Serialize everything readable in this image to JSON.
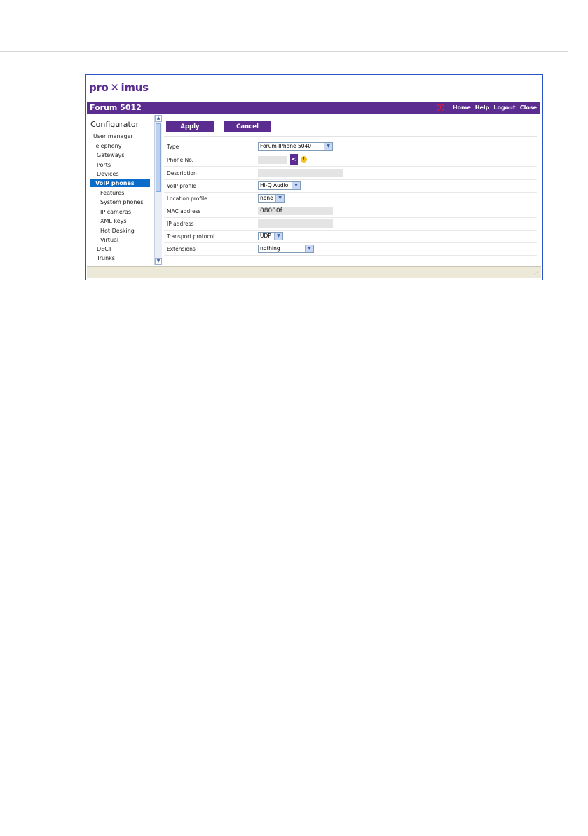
{
  "brand": {
    "logo_left": "pro",
    "logo_x": "✕",
    "logo_right": "imus"
  },
  "titlebar": {
    "title": "Forum 5012",
    "nav": {
      "home": "Home",
      "help": "Help",
      "logout": "Logout",
      "close": "Close"
    },
    "info_icon": "i"
  },
  "sidebar": {
    "title": "Configurator",
    "items": [
      {
        "label": "User manager"
      },
      {
        "label": "Telephony"
      },
      {
        "label": "Gateways"
      },
      {
        "label": "Ports"
      },
      {
        "label": "Devices"
      },
      {
        "label": "VoIP phones"
      },
      {
        "label": "Features"
      },
      {
        "label": "System phones"
      },
      {
        "label": "IP cameras"
      },
      {
        "label": "XML keys"
      },
      {
        "label": "Hot Desking"
      },
      {
        "label": "Virtual"
      },
      {
        "label": "DECT"
      },
      {
        "label": "Trunks"
      }
    ]
  },
  "toolbar": {
    "apply": "Apply",
    "cancel": "Cancel"
  },
  "form": {
    "type": {
      "label": "Type",
      "value": "Forum IPhone 5040"
    },
    "phone_no": {
      "label": "Phone No.",
      "value": "",
      "pick": "<",
      "warn": "!"
    },
    "description": {
      "label": "Description",
      "value": ""
    },
    "voip_profile": {
      "label": "VoIP profile",
      "value": "Hi-Q Audio"
    },
    "location_profile": {
      "label": "Location profile",
      "value": "none"
    },
    "mac_address": {
      "label": "MAC address",
      "value": "08000f"
    },
    "ip_address": {
      "label": "IP address",
      "value": ""
    },
    "transport_protocol": {
      "label": "Transport protocol",
      "value": "UDP"
    },
    "extensions": {
      "label": "Extensions",
      "value": "nothing"
    }
  },
  "icons": {
    "scroll_up": "▲",
    "scroll_down": "▼",
    "chevron": "▼",
    "grip": "⋰"
  },
  "colors": {
    "brand_purple": "#5c2d91",
    "active_blue": "#0a6cc8",
    "frame_border": "#2c53c9"
  }
}
